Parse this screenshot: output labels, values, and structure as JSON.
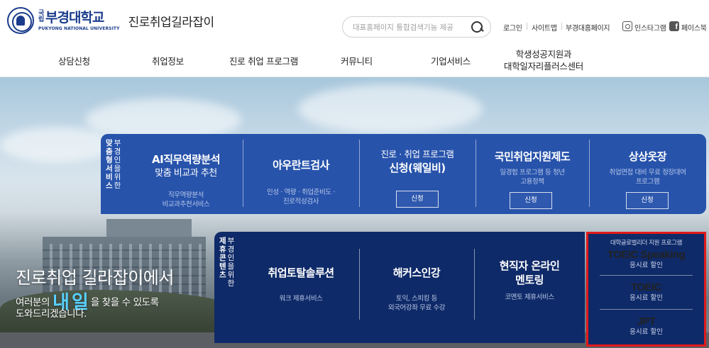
{
  "header": {
    "university": {
      "name_small": "국립",
      "name": "부경대학교",
      "name_en": "PUKYONG NATIONAL UNIVERSITY"
    },
    "site_title": "진로취업길라잡이",
    "search": {
      "placeholder": "대표홈페이지 통합검색기능 제공"
    },
    "util_links": [
      "로그인",
      "사이트맵",
      "부경대홈페이지"
    ],
    "sns": {
      "instagram": "인스타그램",
      "facebook": "페이스북",
      "facebook_glyph": "f"
    }
  },
  "gnb": [
    {
      "label": "상담신청"
    },
    {
      "label": "취업정보"
    },
    {
      "label": "진로 취업 프로그램"
    },
    {
      "label": "커뮤니티"
    },
    {
      "label": "기업서비스"
    },
    {
      "line1": "학생성공지원과",
      "line2": "대학일자리플러스센터"
    }
  ],
  "hero": {
    "title": "진로취업 길라잡이에서",
    "sub_pre": "여러분의",
    "sub_em": "내일",
    "sub_post": "을 찾을 수 있도록",
    "sub2": "도와드리겠습니다."
  },
  "panel1": {
    "label_bold": [
      "맞",
      "춤",
      "형",
      "서",
      "비",
      "스"
    ],
    "label_norm": [
      "부",
      "경",
      "인",
      "을",
      "위",
      "한"
    ],
    "tiles": [
      {
        "title1": "AI직무역량분석",
        "title2": "맞춤 비교과 추천",
        "sub1": "직무역량분석",
        "sub2": "비교과추천서비스"
      },
      {
        "title1": "아우란트검사",
        "sub1": "인성 · 역량 · 취업준비도 ·",
        "sub2": "진로적성검사"
      },
      {
        "title1": "진로 · 취업 프로그램",
        "title2": "신청(웨일비)",
        "button": "신청"
      },
      {
        "title1": "국민취업지원제도",
        "sub1": "일경험 프로그램 등 청년",
        "sub2": "고용정책",
        "button": "신청"
      },
      {
        "title1": "상상옷장",
        "sub1": "취업면접 대비 무료 정장대여",
        "sub2": "프로그램",
        "button": "신청"
      }
    ]
  },
  "panel2": {
    "label_bold": [
      "제",
      "휴",
      "콘",
      "텐",
      "츠"
    ],
    "label_norm": [
      "부",
      "경",
      "인",
      "을",
      "위",
      "한"
    ],
    "tiles": [
      {
        "title1": "취업토탈솔루션",
        "sub1": "워크 제휴서비스"
      },
      {
        "title1": "해커스인강",
        "sub1": "토익, 스피킹 등",
        "sub2": "외국어강좌 무료 수강"
      },
      {
        "title1": "현직자 온라인",
        "title2": "멘토링",
        "sub1": "코멘토 제휴서비스"
      }
    ]
  },
  "toeic": {
    "head": "대학글로벌리더 지원 프로그램",
    "items": [
      {
        "name": "TOEIC Speaking",
        "desc": "응시료 할인"
      },
      {
        "name": "TOEIC",
        "desc": "응시료 할인"
      },
      {
        "name": "JPT",
        "desc": "응시료 할인"
      }
    ],
    "highlight_color": "#e21a1a"
  },
  "colors": {
    "primary_blue": "#2753ab",
    "dark_navy": "#0f2a68",
    "brand": "#1b3c8c"
  }
}
